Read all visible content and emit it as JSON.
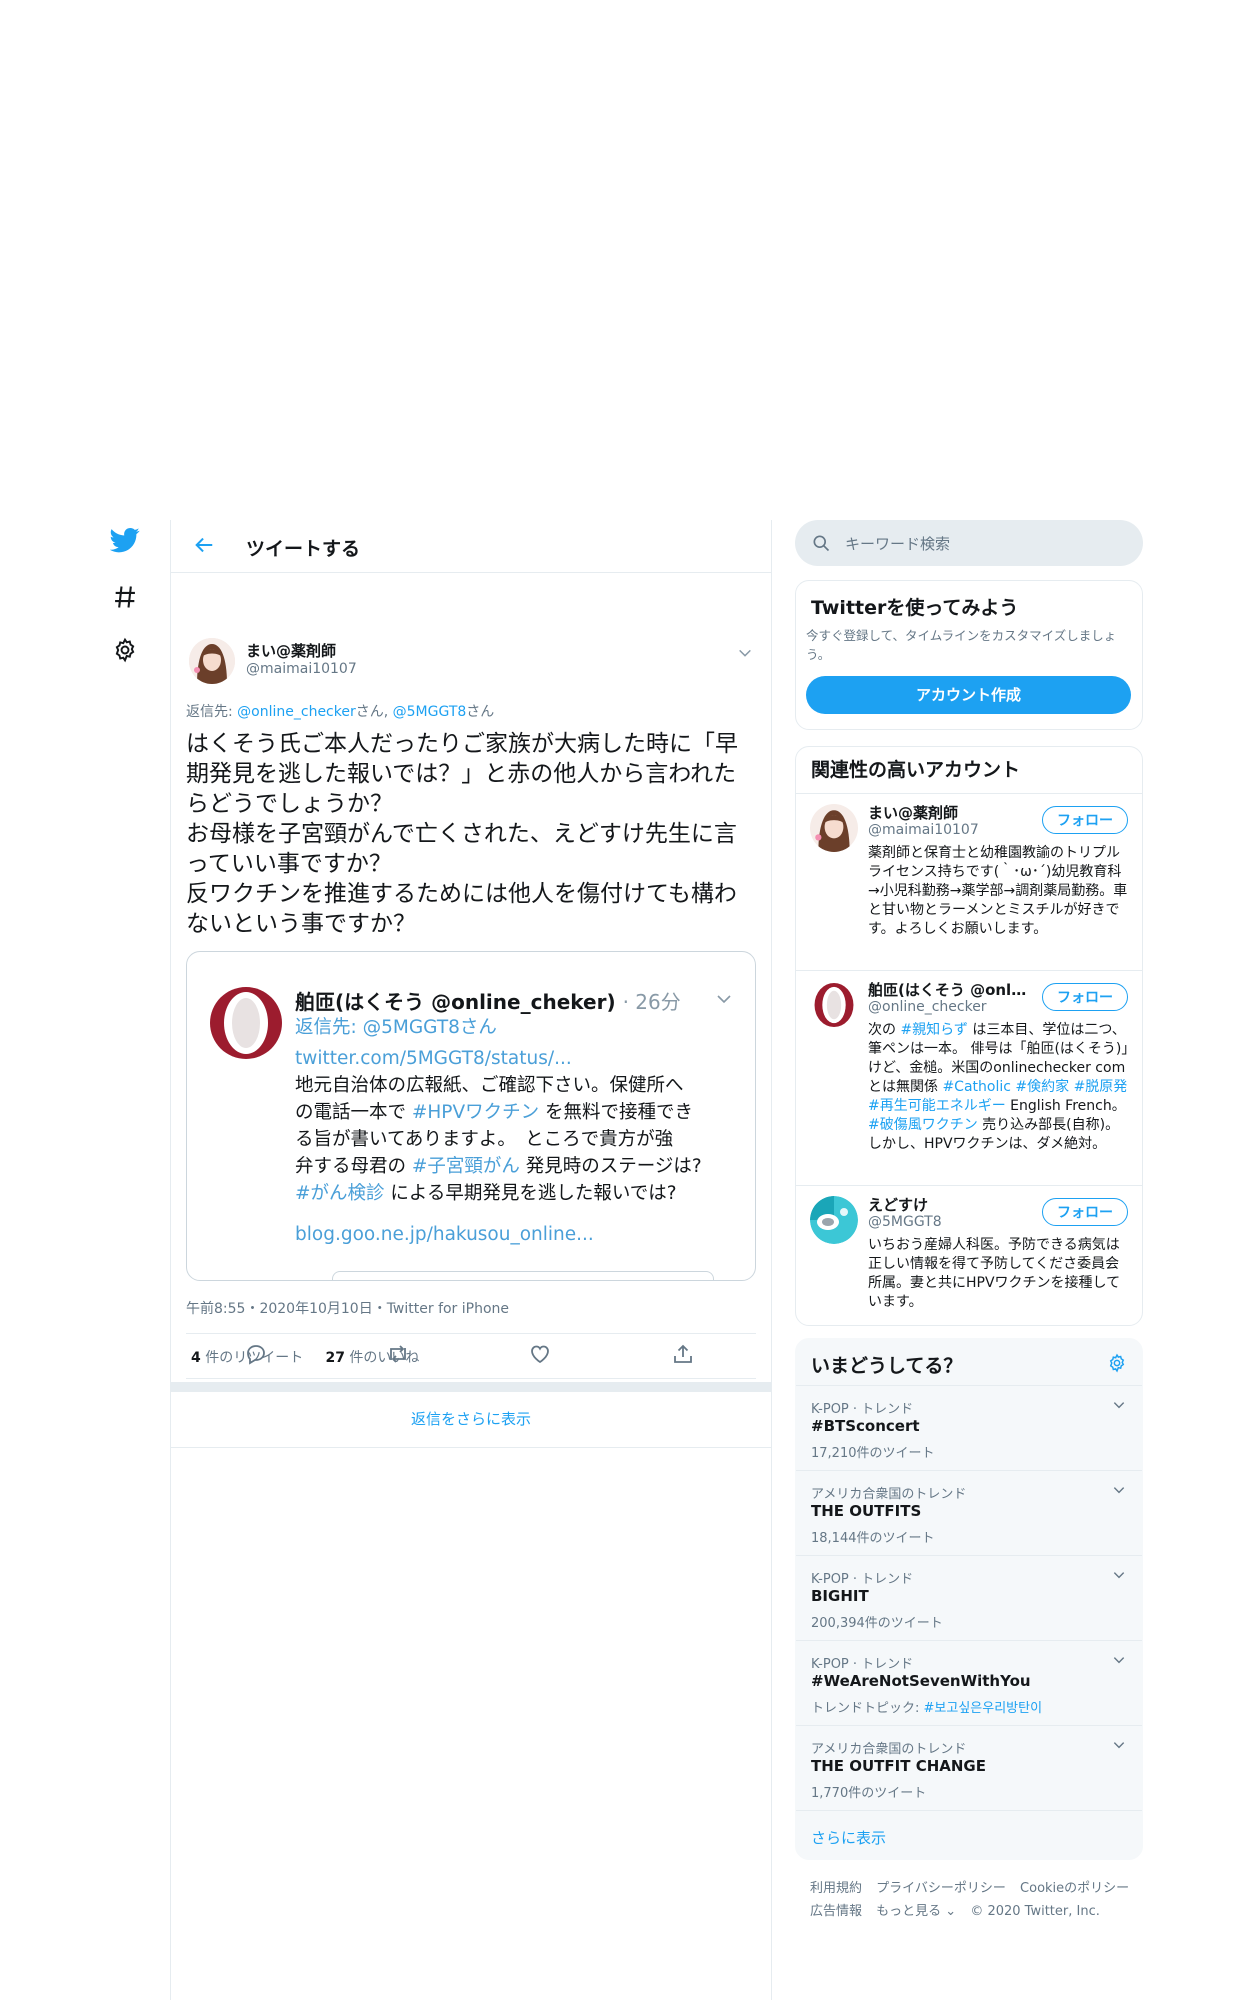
{
  "header": {
    "title": "ツイートする"
  },
  "tweet": {
    "author_name": "まい@薬剤師",
    "author_handle": "@maimai10107",
    "reply_label": "返信先: ",
    "reply_user1": "@online_checker",
    "reply_san1": "さん, ",
    "reply_user2": "@5MGGT8",
    "reply_san2": "さん",
    "text_lines": [
      "はくそう氏ご本人だったりご家族が大病した時に「早期発見を逃した報いでは？」と赤の他人から言われたらどうでしょうか？",
      "お母様を子宮頸がんで亡くされた、えどすけ先生に言っていい事ですか？",
      "反ワクチンを推進するためには他人を傷付けても構わないという事ですか？"
    ],
    "timestamp": "午前8:55・2020年10月10日・Twitter for iPhone",
    "retweets": "4",
    "retweets_label": " 件のリツイート",
    "likes": "27",
    "likes_label": " 件のいいね",
    "show_more": "返信をさらに表示"
  },
  "quote": {
    "name": "舶匝(はくそう @online_cheker)",
    "time": "· 26分",
    "reply": "返信先: @5MGGT8さん",
    "link1": "twitter.com/5MGGT8/status/...",
    "line1": "地元自治体の広報紙、ご確認下さい。保健所へ",
    "line2a": "の電話一本で ",
    "tag_hpv": "#HPVワクチン",
    "line2b": " を無料で接種でき",
    "line3": "る旨が書いてありますよ。　ところで貴方が強",
    "line4a": "弁する母君の ",
    "tag_cervical": "#子宮頸がん",
    "line4b": " 発見時のステージは?",
    "tag_screening": "#がん検診",
    "line5b": " による早期発見を逃した報いでは?",
    "link2": "blog.goo.ne.jp/hakusou_online..."
  },
  "search": {
    "placeholder": "キーワード検索"
  },
  "signup": {
    "title": "Twitterを使ってみよう",
    "desc": "今すぐ登録して、タイムラインをカスタマイズしましょう。",
    "button": "アカウント作成"
  },
  "related": {
    "title": "関連性の高いアカウント",
    "follow_label": "フォロー",
    "accounts": [
      {
        "name": "まい@薬剤師",
        "handle": "@maimai10107",
        "bio": "薬剤師と保育士と幼稚園教諭のトリプルライセンス持ちです(｀･ω･´)幼児教育科→小児科勤務→薬学部→調剤薬局勤務。車と甘い物とラーメンとミスチルが好きです。よろしくお願いします。"
      },
      {
        "name": "舶匝(はくそう @online_checker)",
        "handle": "@online_checker",
        "bio_a": "次の ",
        "bio_tag1": "#親知らず",
        "bio_b": " は三本目、学位は二つ、筆ペンは一本。 俳号は「舶匝(はくそう)」けど、金槌。米国のonlinechecker comとは無関係 ",
        "bio_tag2": "#Catholic #倹約家 #脱原発 #再生可能エネルギー",
        "bio_c": " English French。",
        "bio_tag3": "#破傷風ワクチン",
        "bio_d": " 売り込み部長(自称)。しかし、HPVワクチンは、ダメ絶対。"
      },
      {
        "name": "えどすけ",
        "handle": "@5MGGT8",
        "bio": "いちおう産婦人科医。予防できる病気は正しい情報を得て予防してくださ委員会所属。妻と共にHPVワクチンを接種しています。"
      }
    ]
  },
  "trends": {
    "title": "いまどうしてる？",
    "items": [
      {
        "context": "K-POP · トレンド",
        "name": "#BTSconcert",
        "stat": "17,210件のツイート"
      },
      {
        "context": "アメリカ合衆国のトレンド",
        "name": "THE OUTFITS",
        "stat": "18,144件のツイート"
      },
      {
        "context": "K-POP · トレンド",
        "name": "BIGHIT",
        "stat": "200,394件のツイート"
      },
      {
        "context": "K-POP · トレンド",
        "name": "#WeAreNotSevenWithYou",
        "stat_label": "トレンドトピック: ",
        "stat_link": "#보고싶은우리방탄이"
      },
      {
        "context": "アメリカ合衆国のトレンド",
        "name": "THE OUTFIT CHANGE",
        "stat": "1,770件のツイート"
      }
    ],
    "more": "さらに表示"
  },
  "footer": {
    "links": [
      "利用規約",
      "プライバシーポリシー",
      "Cookieのポリシー",
      "広告情報",
      "もっと見る ⌄"
    ],
    "copyright": "© 2020 Twitter, Inc."
  },
  "colors": {
    "brand_blue": "#1da1f2",
    "border": "#e6ecf0",
    "muted_text": "#657786"
  }
}
